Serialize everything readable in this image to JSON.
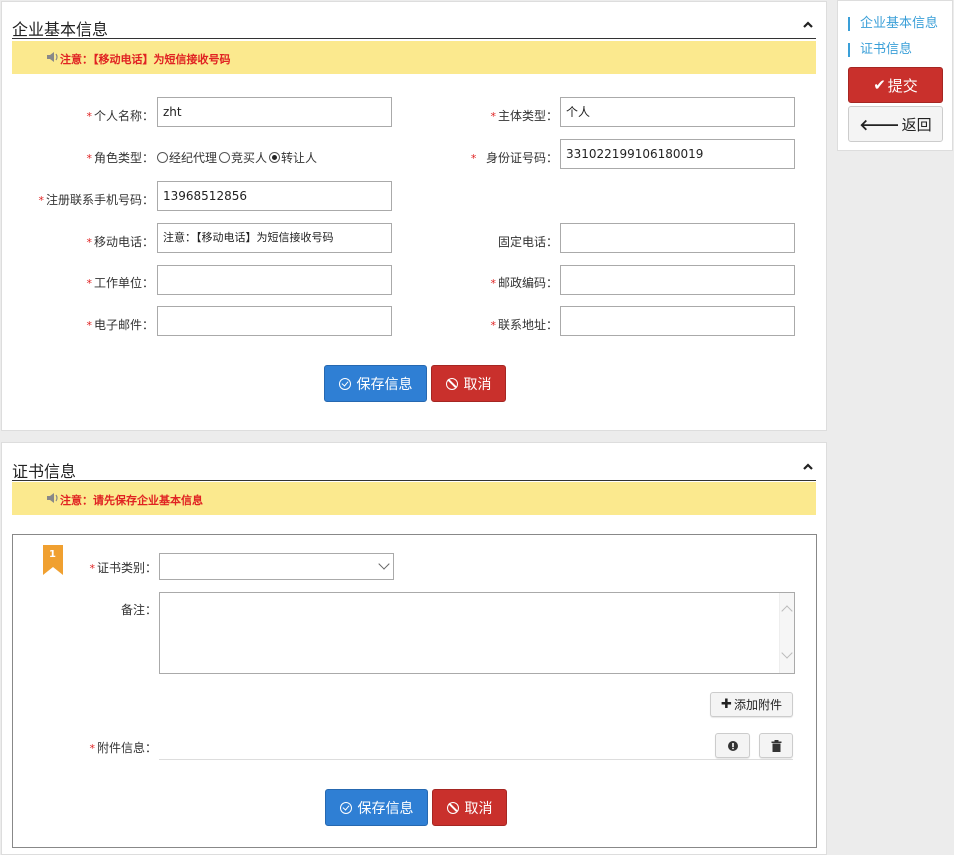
{
  "company": {
    "title": "企业基本信息",
    "notice": "注意：【移动电话】为短信接收号码",
    "fields": {
      "name_label": "个人名称：",
      "name_value": "zht",
      "subject_type_label": "主体类型：",
      "subject_type_value": "个人",
      "role_label": "角色类型：",
      "role_options": [
        "经纪代理",
        "竞买人",
        "转让人"
      ],
      "role_selected": "转让人",
      "id_label": "身份证号码：",
      "id_value": "331022199106180019",
      "reg_phone_label": "注册联系手机号码：",
      "reg_phone_value": "13968512856",
      "mobile_label": "移动电话：",
      "mobile_placeholder": "注意：【移动电话】为短信接收号码",
      "landline_label": "固定电话：",
      "work_label": "工作单位：",
      "postcode_label": "邮政编码：",
      "email_label": "电子邮件：",
      "address_label": "联系地址："
    },
    "save_label": "保存信息",
    "cancel_label": "取消"
  },
  "certificate": {
    "title": "证书信息",
    "notice": "注意：请先保存企业基本信息",
    "index": "1",
    "category_label": "证书类别：",
    "remark_label": "备注：",
    "add_attachment_label": "添加附件",
    "attachment_label": "附件信息：",
    "save_label": "保存信息",
    "cancel_label": "取消"
  },
  "sidebar": {
    "links": [
      "企业基本信息",
      "证书信息"
    ],
    "submit_label": "提交",
    "back_label": "返回"
  },
  "colors": {
    "notice_bg": "#fbe98e",
    "notice_text": "#e02222",
    "primary": "#2f7fd4",
    "danger": "#c9302c",
    "link": "#3a9fd8"
  }
}
